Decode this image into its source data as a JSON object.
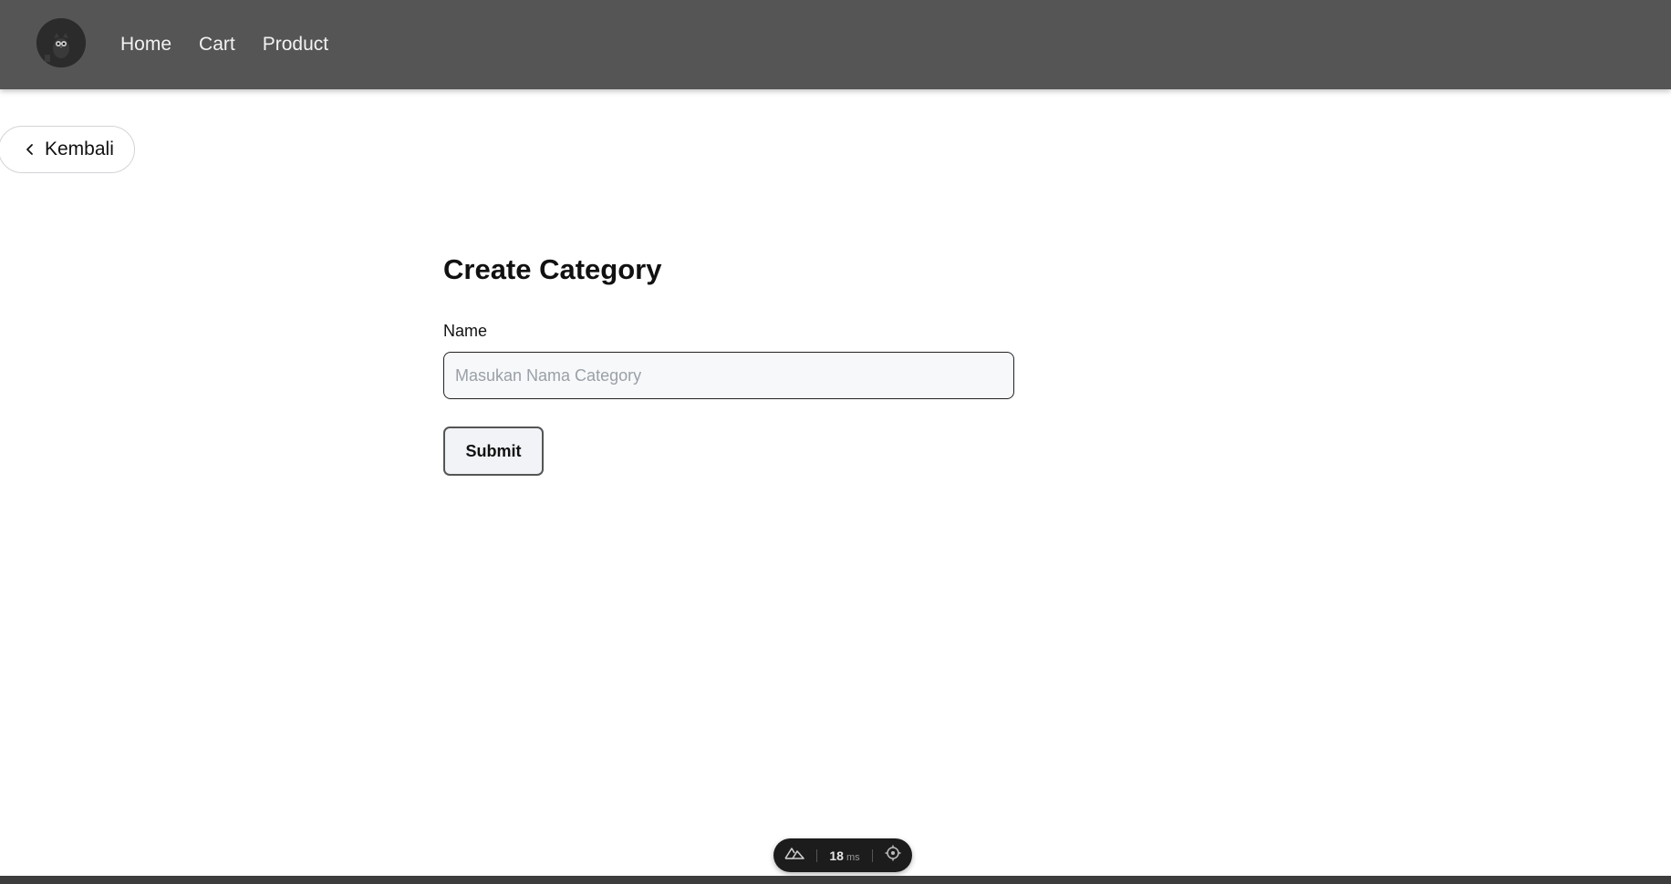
{
  "navbar": {
    "logo_icon": "owl-avatar-icon",
    "links": [
      "Home",
      "Cart",
      "Product"
    ]
  },
  "back_button": {
    "label": "Kembali",
    "icon": "chevron-left-icon"
  },
  "form": {
    "title": "Create Category",
    "name_label": "Name",
    "name_placeholder": "Masukan Nama Category",
    "name_value": "",
    "submit_label": "Submit"
  },
  "devtools": {
    "logo_icon": "nuxt-logo-icon",
    "timing_value": "18",
    "timing_unit": "ms",
    "inspect_icon": "crosshair-icon"
  },
  "colors": {
    "navbar_bg": "#555555",
    "nav_text": "#f2f2f2",
    "input_bg": "#f7f8fa",
    "devtools_bg": "#1c1c1c"
  }
}
